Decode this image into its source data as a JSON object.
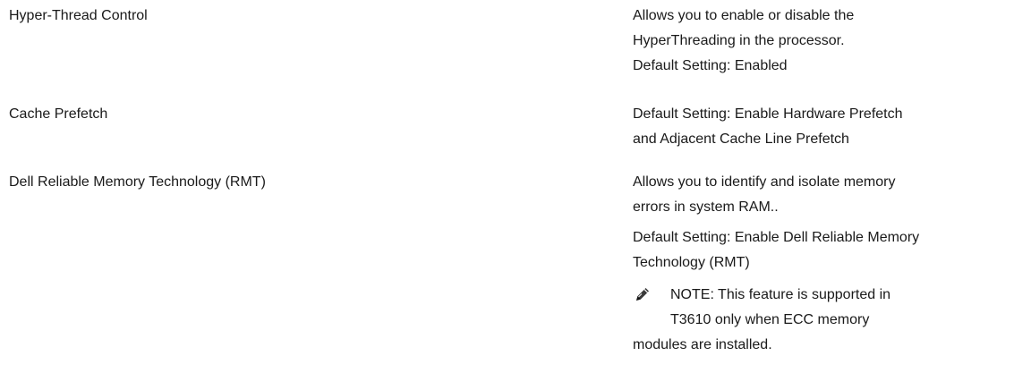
{
  "settings": [
    {
      "name": "Hyper-Thread Control",
      "description": [
        "Allows you to enable or disable the",
        "HyperThreading in the processor.",
        "Default Setting: Enabled"
      ]
    },
    {
      "name": "Cache Prefetch",
      "description": [
        "Default Setting: Enable Hardware Prefetch",
        "and Adjacent Cache Line Prefetch"
      ]
    },
    {
      "name": "Dell Reliable Memory Technology (RMT)",
      "description": [
        "Allows you to identify and isolate memory",
        "errors in system RAM..",
        "Default Setting: Enable Dell Reliable Memory",
        "Technology (RMT)"
      ],
      "note": {
        "icon": "pencil-note-icon",
        "lines": [
          "NOTE: This feature is supported in",
          "T3610 only when ECC memory",
          "modules are installed."
        ]
      }
    }
  ]
}
